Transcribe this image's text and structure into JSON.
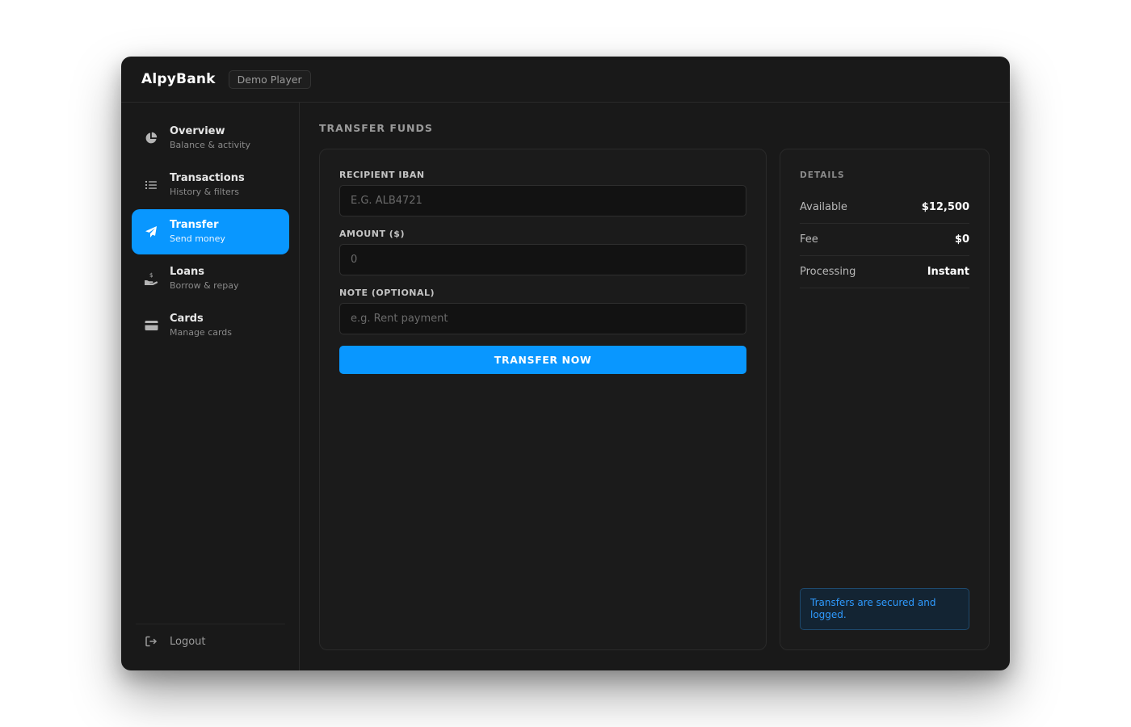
{
  "app": {
    "brand": "AlpyBank",
    "player_badge": "Demo Player"
  },
  "sidebar": {
    "items": [
      {
        "title": "Overview",
        "subtitle": "Balance & activity",
        "icon": "pie-chart-icon",
        "active": false
      },
      {
        "title": "Transactions",
        "subtitle": "History & filters",
        "icon": "list-icon",
        "active": false
      },
      {
        "title": "Transfer",
        "subtitle": "Send money",
        "icon": "paper-plane-icon",
        "active": true
      },
      {
        "title": "Loans",
        "subtitle": "Borrow & repay",
        "icon": "hand-dollar-icon",
        "active": false
      },
      {
        "title": "Cards",
        "subtitle": "Manage cards",
        "icon": "credit-card-icon",
        "active": false
      }
    ],
    "logout_label": "Logout",
    "logout_icon": "logout-icon"
  },
  "main": {
    "section_title": "TRANSFER FUNDS",
    "form": {
      "iban_label": "RECIPIENT IBAN",
      "iban_placeholder": "E.G. ALB4721",
      "amount_label": "AMOUNT ($)",
      "amount_placeholder": "0",
      "note_label": "NOTE (OPTIONAL)",
      "note_placeholder": "e.g. Rent payment",
      "submit_label": "TRANSFER NOW"
    },
    "details": {
      "title": "DETAILS",
      "rows": [
        {
          "label": "Available",
          "value": "$12,500"
        },
        {
          "label": "Fee",
          "value": "$0"
        },
        {
          "label": "Processing",
          "value": "Instant"
        }
      ],
      "notice": "Transfers are secured and logged."
    }
  },
  "colors": {
    "accent": "#0997ff",
    "window_bg": "#191919",
    "notice_text": "#2f9bff"
  }
}
